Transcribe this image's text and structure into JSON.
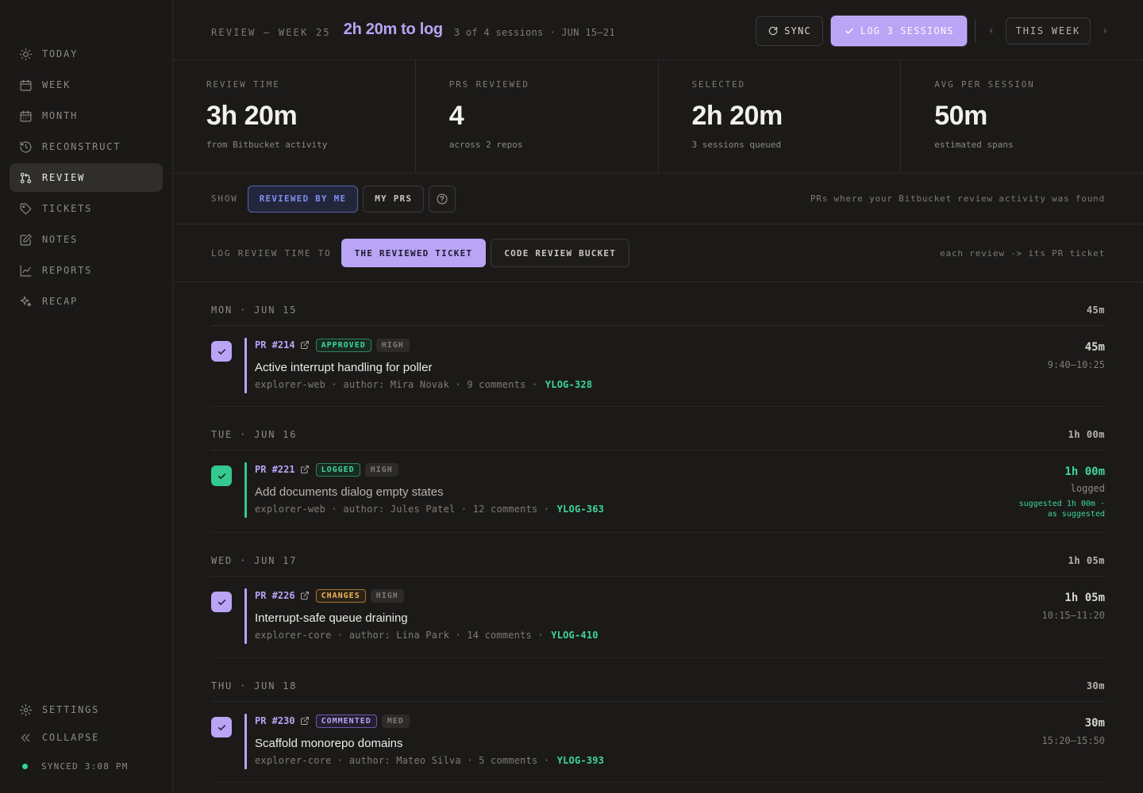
{
  "sidebar": {
    "items": [
      {
        "label": "TODAY",
        "icon": "sun-icon"
      },
      {
        "label": "WEEK",
        "icon": "calendar-week-icon"
      },
      {
        "label": "MONTH",
        "icon": "calendar-month-icon"
      },
      {
        "label": "RECONSTRUCT",
        "icon": "history-icon"
      },
      {
        "label": "REVIEW",
        "icon": "git-pull-request-icon",
        "active": true
      },
      {
        "label": "TICKETS",
        "icon": "tag-icon"
      },
      {
        "label": "NOTES",
        "icon": "note-edit-icon"
      },
      {
        "label": "REPORTS",
        "icon": "line-chart-icon"
      },
      {
        "label": "RECAP",
        "icon": "sparkles-icon"
      }
    ],
    "settings_label": "SETTINGS",
    "collapse_label": "COLLAPSE",
    "sync_status": "SYNCED 3:08 PM"
  },
  "header": {
    "eyebrow": "REVIEW — WEEK 25",
    "title": "2h 20m to log",
    "subtitle": "3 of 4 sessions · JUN 15–21",
    "sync_label": "SYNC",
    "log_label": "LOG 3 SESSIONS",
    "week_label": "THIS WEEK",
    "prev": "‹",
    "next": "›"
  },
  "stats": [
    {
      "label": "REVIEW TIME",
      "value": "3h 20m",
      "sub": "from Bitbucket activity"
    },
    {
      "label": "PRS REVIEWED",
      "value": "4",
      "sub": "across 2 repos"
    },
    {
      "label": "SELECTED",
      "value": "2h 20m",
      "sub": "3 sessions queued"
    },
    {
      "label": "AVG PER SESSION",
      "value": "50m",
      "sub": "estimated spans"
    }
  ],
  "filter": {
    "label": "SHOW",
    "options": [
      "REVIEWED BY ME",
      "MY PRS"
    ],
    "selected": "REVIEWED BY ME",
    "hint": "PRs where your Bitbucket review activity was found"
  },
  "log_target": {
    "label": "LOG REVIEW TIME TO",
    "options": [
      "THE REVIEWED TICKET",
      "CODE REVIEW BUCKET"
    ],
    "selected": "THE REVIEWED TICKET",
    "hint": "each review -> its PR ticket"
  },
  "colors": {
    "accent": "#b9a4f5",
    "green": "#3fd59c",
    "amber": "#f0b65a",
    "blue": "#7f8ef0"
  },
  "days": [
    {
      "label": "MON · JUN 15",
      "total": "45m",
      "entries": [
        {
          "pr": "PR #214",
          "status": "APPROVED",
          "level": "HIGH",
          "title": "Active interrupt handling for poller",
          "repo": "explorer-web",
          "author": "author: Mira Novak",
          "comments": "9 comments",
          "ticket": "YLOG-328",
          "duration": "45m",
          "span": "9:40–10:25",
          "checked": true,
          "logged": false
        }
      ]
    },
    {
      "label": "TUE · JUN 16",
      "total": "1h 00m",
      "entries": [
        {
          "pr": "PR #221",
          "status": "LOGGED",
          "level": "HIGH",
          "title": "Add documents dialog empty states",
          "repo": "explorer-web",
          "author": "author: Jules Patel",
          "comments": "12 comments",
          "ticket": "YLOG-363",
          "duration": "1h 00m",
          "span": "logged",
          "suggestion_1": "suggested 1h 00m ·",
          "suggestion_2": "as suggested",
          "checked": true,
          "logged": true
        }
      ]
    },
    {
      "label": "WED · JUN 17",
      "total": "1h 05m",
      "entries": [
        {
          "pr": "PR #226",
          "status": "CHANGES",
          "level": "HIGH",
          "title": "Interrupt-safe queue draining",
          "repo": "explorer-core",
          "author": "author: Lina Park",
          "comments": "14 comments",
          "ticket": "YLOG-410",
          "duration": "1h 05m",
          "span": "10:15–11:20",
          "checked": true,
          "logged": false
        }
      ]
    },
    {
      "label": "THU · JUN 18",
      "total": "30m",
      "entries": [
        {
          "pr": "PR #230",
          "status": "COMMENTED",
          "level": "MED",
          "title": "Scaffold monorepo domains",
          "repo": "explorer-core",
          "author": "author: Mateo Silva",
          "comments": "5 comments",
          "ticket": "YLOG-393",
          "duration": "30m",
          "span": "15:20–15:50",
          "checked": true,
          "logged": false
        }
      ]
    }
  ]
}
